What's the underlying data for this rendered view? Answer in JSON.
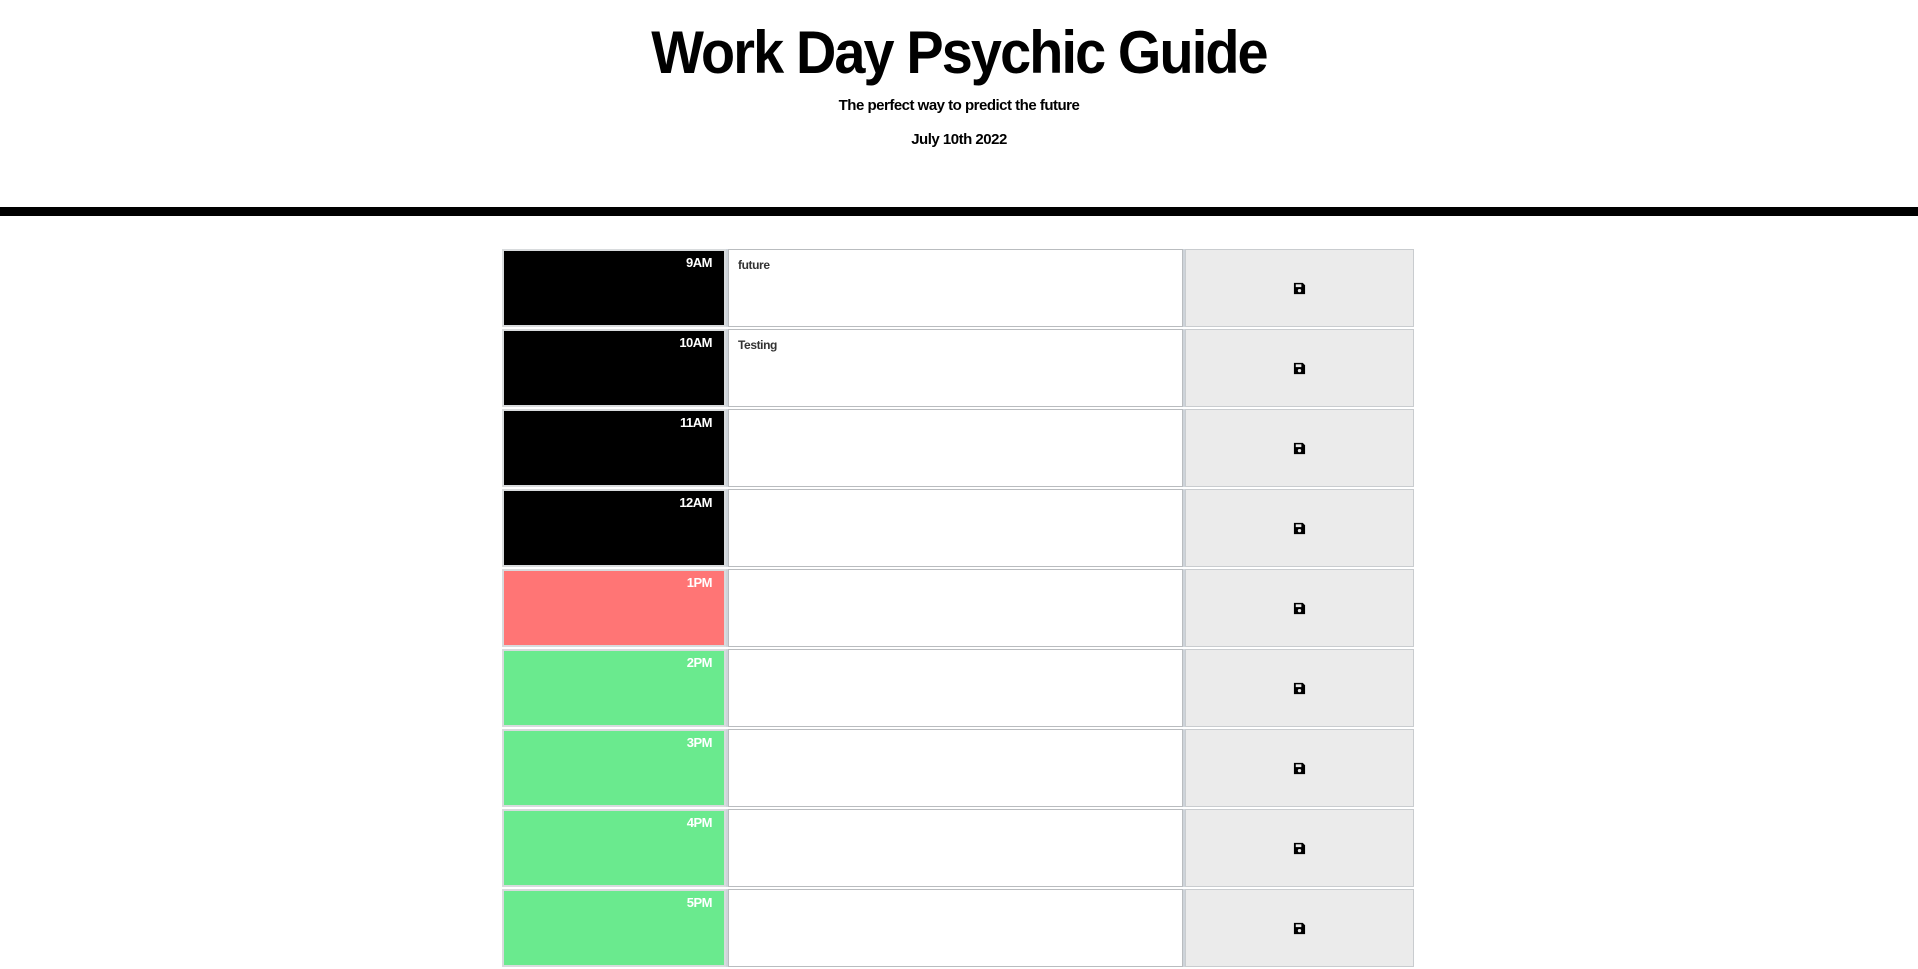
{
  "header": {
    "title": "Work Day Psychic Guide",
    "subtitle": "The perfect way to predict the future",
    "date": "July 10th 2022"
  },
  "colors": {
    "past": "#000000",
    "present": "#ff7575",
    "future": "#6aea8e",
    "save_button_bg": "#ebebeb"
  },
  "rows": [
    {
      "hour": "9AM",
      "text": "future",
      "state": "past",
      "save_icon": "floppy-disk-icon"
    },
    {
      "hour": "10AM",
      "text": "Testing",
      "state": "past",
      "save_icon": "floppy-disk-icon"
    },
    {
      "hour": "11AM",
      "text": "",
      "state": "past",
      "save_icon": "floppy-disk-icon"
    },
    {
      "hour": "12AM",
      "text": "",
      "state": "past",
      "save_icon": "floppy-disk-icon"
    },
    {
      "hour": "1PM",
      "text": "",
      "state": "present",
      "save_icon": "floppy-disk-icon"
    },
    {
      "hour": "2PM",
      "text": "",
      "state": "future",
      "save_icon": "floppy-disk-icon"
    },
    {
      "hour": "3PM",
      "text": "",
      "state": "future",
      "save_icon": "floppy-disk-icon"
    },
    {
      "hour": "4PM",
      "text": "",
      "state": "future",
      "save_icon": "floppy-disk-icon"
    },
    {
      "hour": "5PM",
      "text": "",
      "state": "future",
      "save_icon": "floppy-disk-icon"
    }
  ]
}
